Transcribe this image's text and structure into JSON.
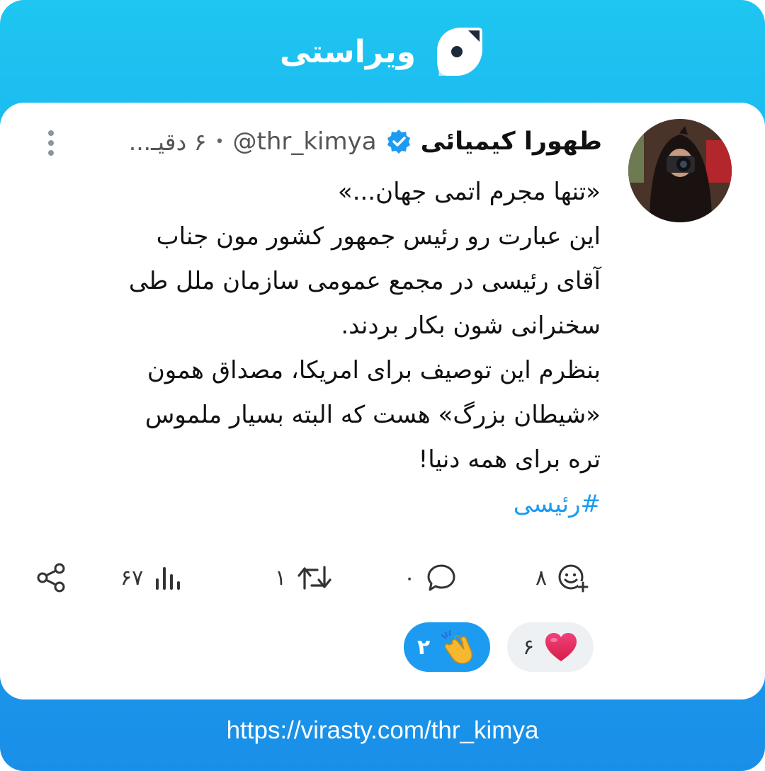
{
  "app": {
    "brand_name": "ویراستی",
    "footer_url": "https://virasty.com/thr_kimya"
  },
  "colors": {
    "accent": "#1d9bf0",
    "header_gradient_top": "#1ec6f0",
    "header_gradient_bottom": "#1a8fe8",
    "like": "#e8255b"
  },
  "post": {
    "author_name": "طهورا کیمیائی",
    "handle": "@thr_kimya",
    "separator": "•",
    "time": "۶ دقیـ...",
    "lines": [
      "«تنها مجرم اتمی جهان...»",
      "این عبارت رو رئیس جمهور کشور مون جناب",
      "آقای رئیسی در مجمع عمومی سازمان ملل طی",
      "سخنرانی شون بکار بردند.",
      "بنظرم این توصیف برای امریکا، مصداق همون",
      "«شیطان بزرگ» هست که البته بسیار ملموس",
      "تره برای همه دنیا!"
    ],
    "hashtag": "#رئیسی"
  },
  "actions": {
    "reactions_count": "۸",
    "replies_count": "۰",
    "reposts_count": "۱",
    "views_count": "۶۷"
  },
  "reactions": {
    "heart_count": "۶",
    "clap_count": "۲"
  },
  "icons": {
    "brand": "virasty-logo-icon",
    "verified": "verified-badge-icon",
    "more": "more-vertical-icon",
    "react": "add-reaction-icon",
    "reply": "comment-icon",
    "repost": "repost-icon",
    "views": "views-chart-icon",
    "share": "share-icon",
    "heart": "heart-icon",
    "clap": "clapping-hands-icon"
  }
}
